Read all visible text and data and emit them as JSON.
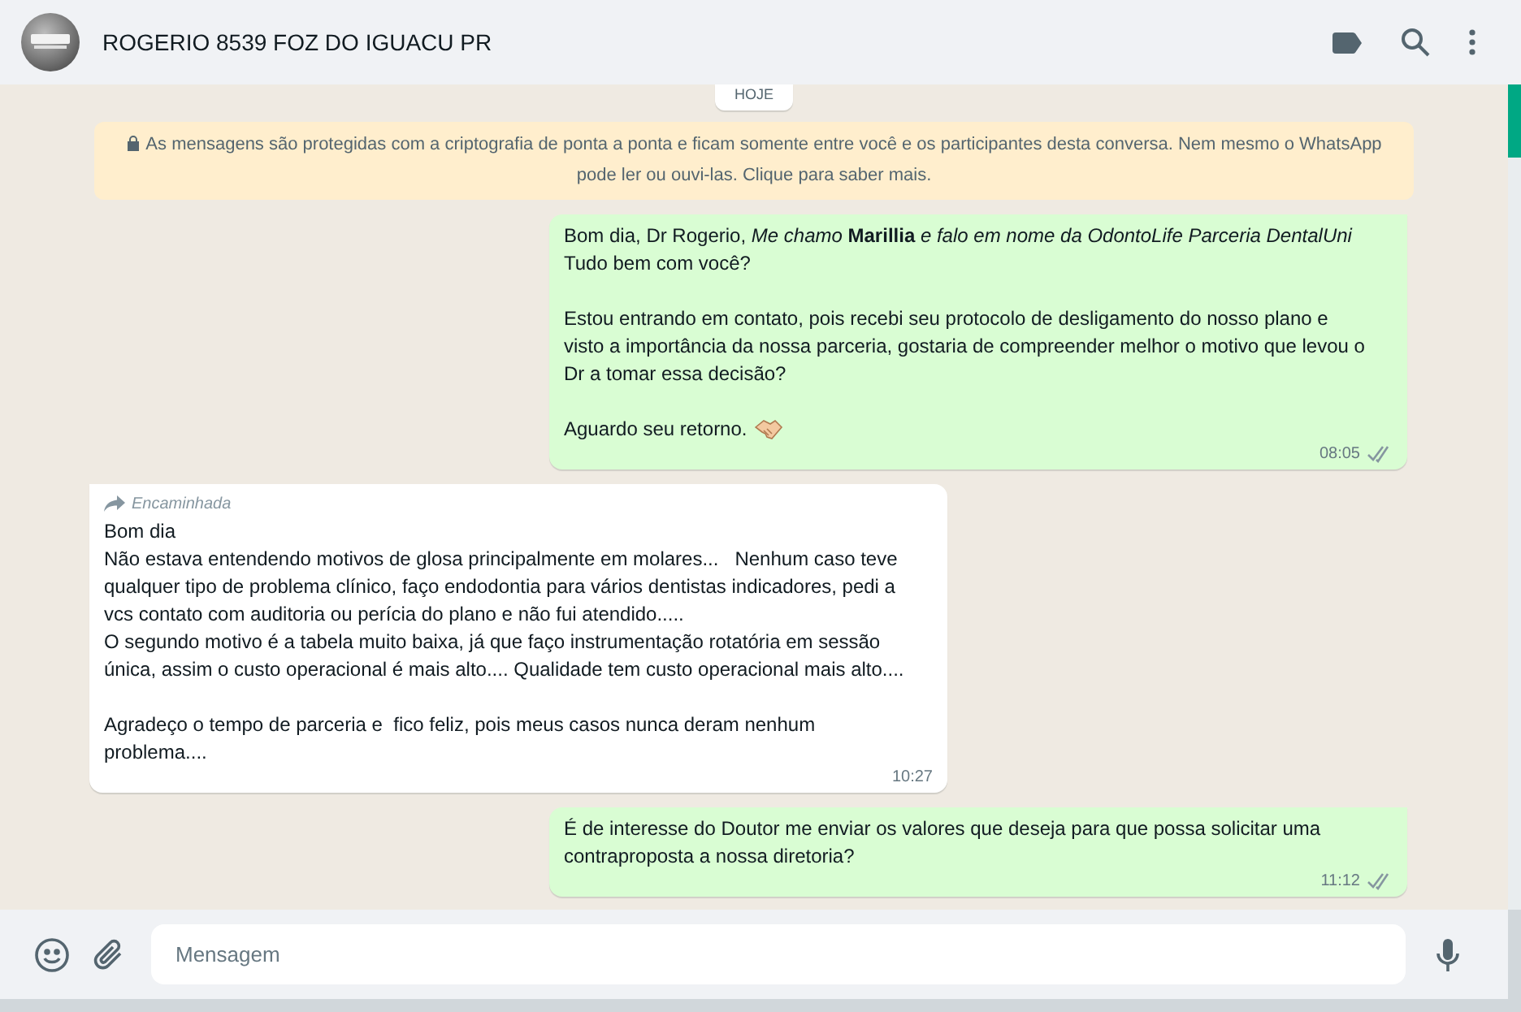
{
  "header": {
    "contact_name": "ROGERIO 8539 FOZ DO IGUACU PR"
  },
  "date_chip": "HOJE",
  "encryption_notice": "As mensagens são protegidas com a criptografia de ponta a ponta e ficam somente entre você e os participantes desta conversa. Nem mesmo o WhatsApp pode ler ou ouvi-las. Clique para saber mais.",
  "messages": [
    {
      "kind": "outgoing",
      "forwarded": false,
      "paragraphs": [
        "Bom dia, Dr Rogerio, *Me chamo* **Marillia** *e falo em nome da OdontoLife Parceria DentalUni*\nTudo bem com você?",
        "Estou entrando em contato, pois recebi seu protocolo de desligamento do nosso plano e visto a importância da nossa parceria, gostaria de compreender melhor o motivo que levou o Dr a tomar essa decisão?",
        "Aguardo seu retorno."
      ],
      "emoji": true,
      "time": "08:05",
      "delivered": true
    },
    {
      "kind": "incoming",
      "forwarded": true,
      "forwarded_label": "Encaminhada",
      "paragraphs": [
        "Bom dia\nNão estava entendendo motivos de glosa principalmente em molares...   Nenhum caso teve qualquer tipo de problema clínico, faço endodontia para vários dentistas indicadores, pedi a vcs contato com auditoria ou perícia do plano e não fui atendido.....\nO segundo motivo é a tabela muito baixa, já que faço instrumentação rotatória em sessão única, assim o custo operacional é mais alto.... Qualidade tem custo operacional mais alto....",
        "Agradeço o tempo de parceria e  fico feliz, pois meus casos nunca deram nenhum problema...."
      ],
      "emoji": false,
      "time": "10:27",
      "delivered": false
    },
    {
      "kind": "outgoing",
      "forwarded": false,
      "paragraphs": [
        "É de interesse do Doutor me enviar os valores que deseja para que possa solicitar uma contraproposta a nossa diretoria?"
      ],
      "emoji": false,
      "time": "11:12",
      "delivered": true
    }
  ],
  "composer": {
    "placeholder": "Mensagem"
  }
}
